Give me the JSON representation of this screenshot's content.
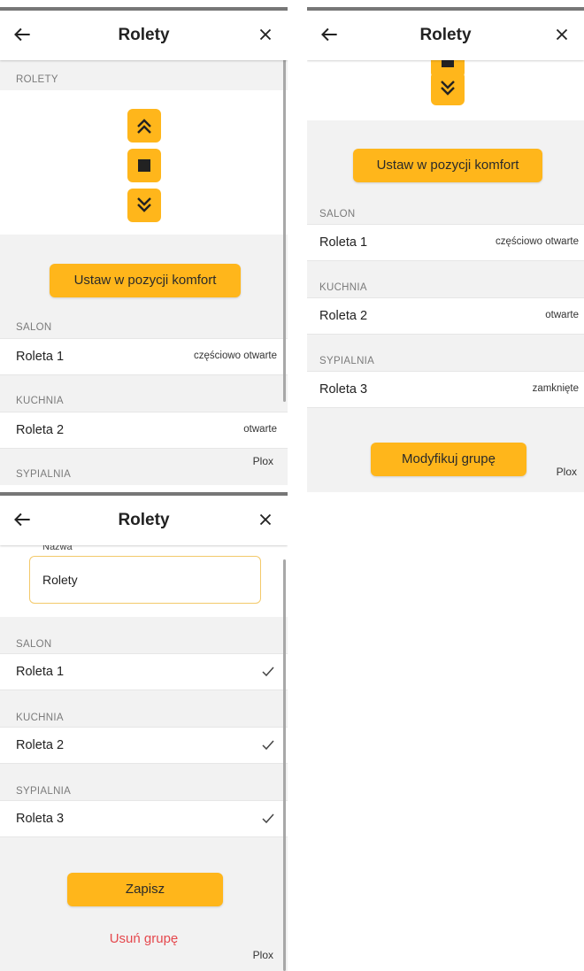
{
  "screens": {
    "first": {
      "title": "Rolety",
      "section_rolety": "ROLETY",
      "comfort_button": "Ustaw w pozycji komfort",
      "groups": [
        {
          "section": "SALON",
          "item": "Roleta 1",
          "status": "częściowo otwarte"
        },
        {
          "section": "KUCHNIA",
          "item": "Roleta 2",
          "status": "otwarte"
        },
        {
          "section": "SYPIALNIA"
        }
      ],
      "footer": "Plox"
    },
    "second": {
      "title": "Rolety",
      "comfort_button": "Ustaw w pozycji komfort",
      "groups": [
        {
          "section": "SALON",
          "item": "Roleta 1",
          "status": "częściowo otwarte"
        },
        {
          "section": "KUCHNIA",
          "item": "Roleta 2",
          "status": "otwarte"
        },
        {
          "section": "SYPIALNIA",
          "item": "Roleta 3",
          "status": "zamknięte"
        }
      ],
      "modify_button": "Modyfikuj grupę",
      "footer": "Plox"
    },
    "third": {
      "title": "Rolety",
      "name_label": "Nazwa",
      "name_value": "Rolety",
      "groups": [
        {
          "section": "SALON",
          "item": "Roleta 1"
        },
        {
          "section": "KUCHNIA",
          "item": "Roleta 2"
        },
        {
          "section": "SYPIALNIA",
          "item": "Roleta 3"
        }
      ],
      "save_button": "Zapisz",
      "delete_link": "Usuń grupę",
      "footer": "Plox"
    }
  },
  "icons": {
    "back": "arrow-left-icon",
    "close": "close-icon",
    "up": "double-chevron-up-icon",
    "stop": "stop-icon",
    "down": "double-chevron-down-icon",
    "check": "checkmark-icon"
  },
  "colors": {
    "accent": "#ffb61b",
    "danger": "#e5484d",
    "background": "#f2f2f2",
    "surface": "#ffffff",
    "input_border": "#f3c96a"
  }
}
